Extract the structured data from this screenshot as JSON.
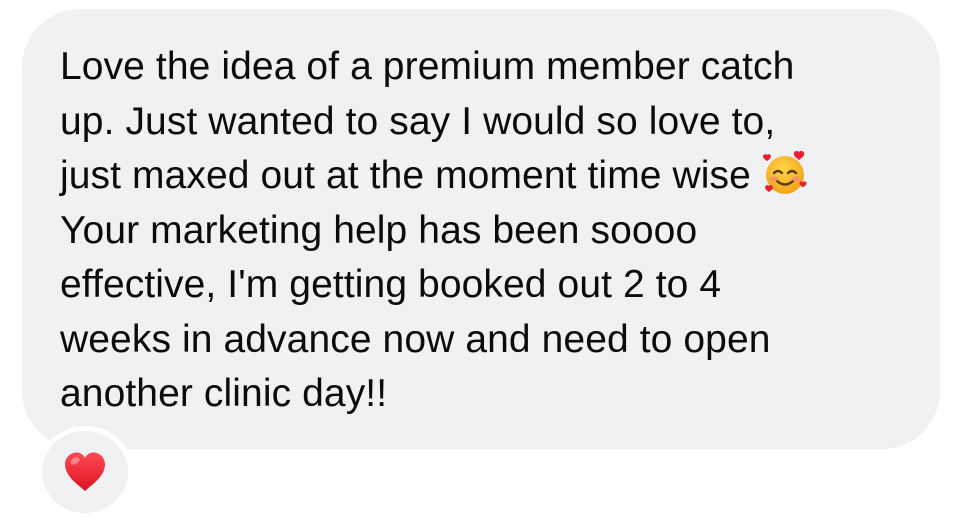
{
  "message": {
    "lines": [
      "Love the idea of a premium member catch",
      "up. Just wanted to say I would so love to,",
      "just maxed out at the moment time wise",
      "Your marketing help has been soooo",
      "effective, I'm getting booked out 2 to 4",
      "weeks in advance now and need to open",
      "another clinic day!!"
    ],
    "inline_emoji": "smiling-face-with-hearts-icon"
  },
  "reaction": {
    "emoji": "red-heart-icon",
    "count_visible": false
  },
  "colors": {
    "bubble": "#f0f1f3",
    "text": "#0b0b0c",
    "heart": "#e8202f"
  }
}
